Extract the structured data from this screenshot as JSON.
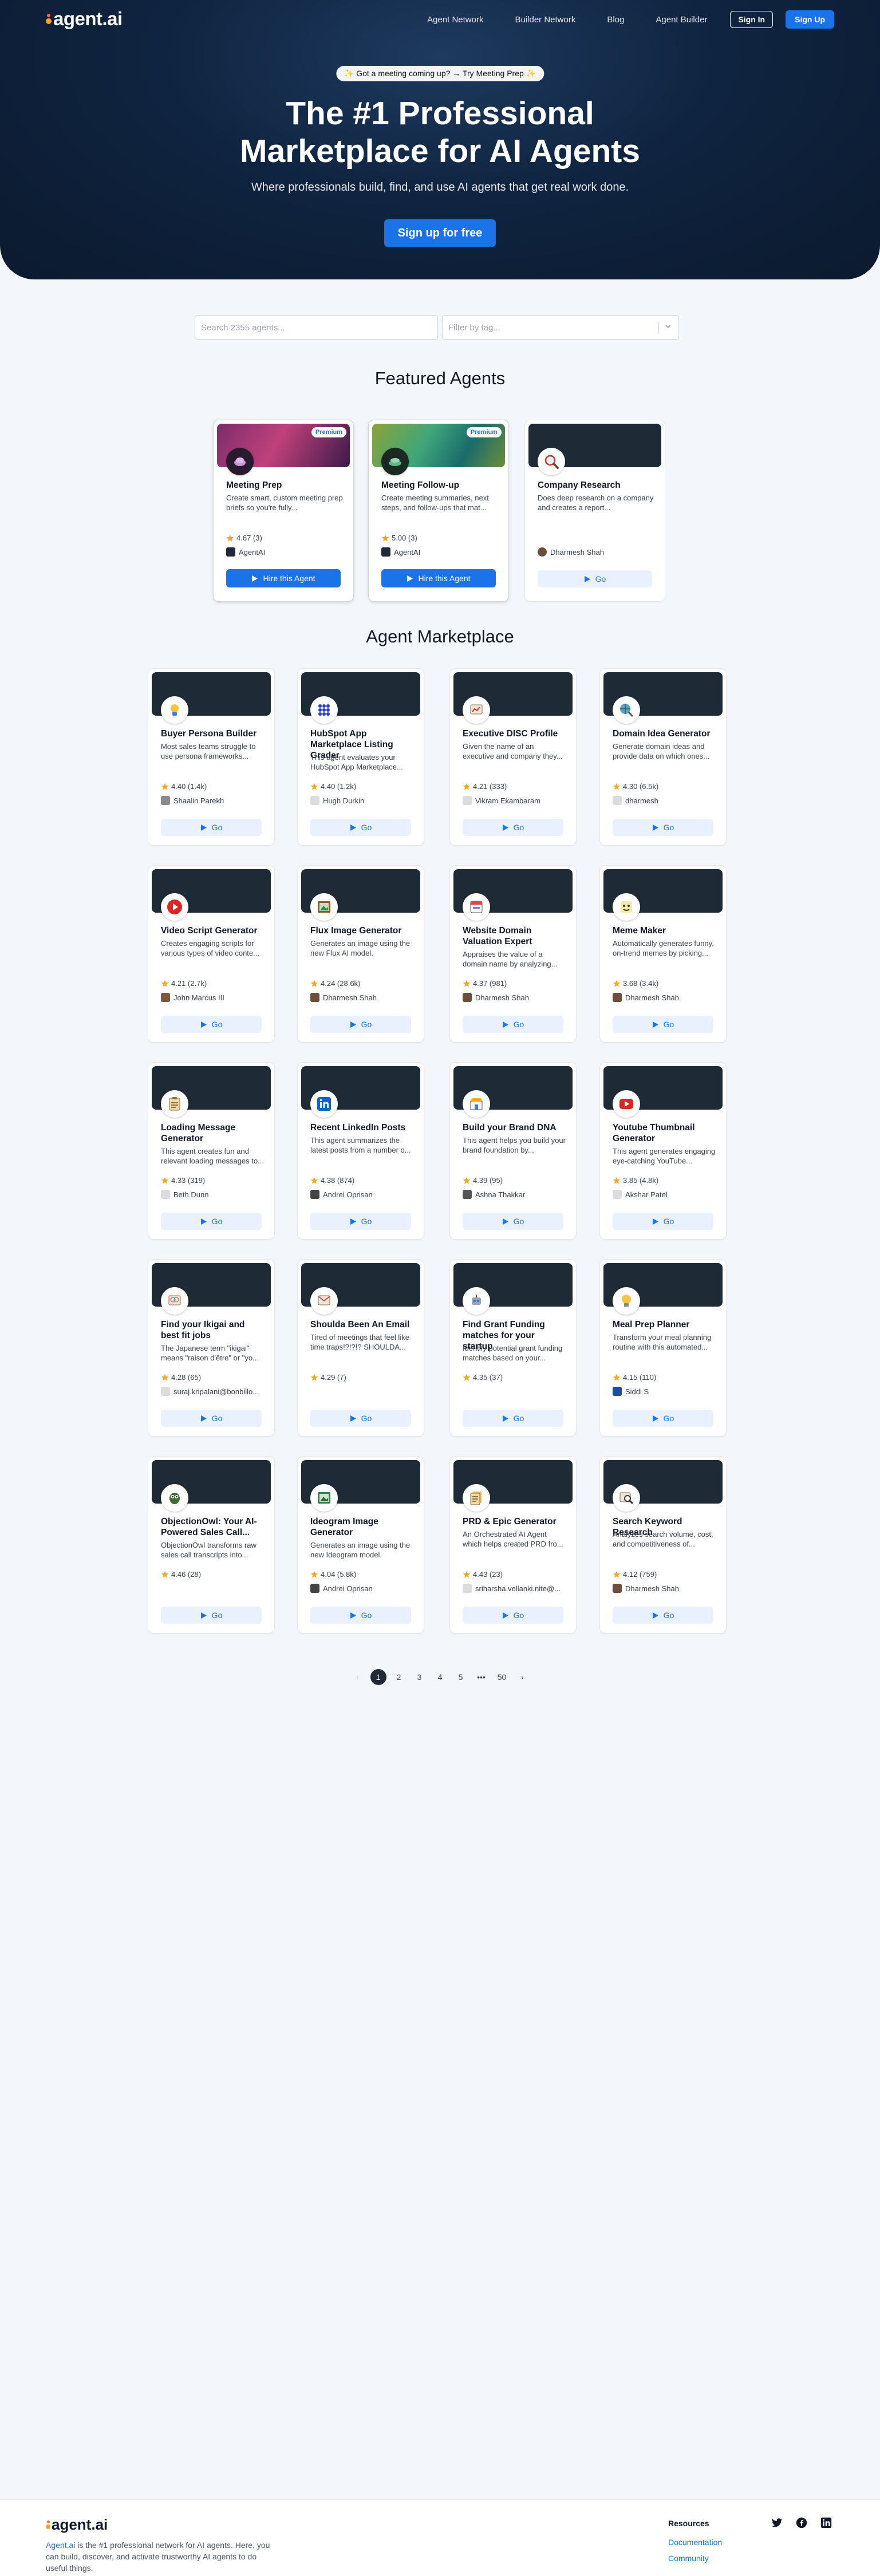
{
  "nav": {
    "logo": "agent.ai",
    "links": [
      "Agent Network",
      "Builder Network",
      "Blog",
      "Agent Builder"
    ],
    "sign_in": "Sign In",
    "sign_up": "Sign Up"
  },
  "hero": {
    "promo": "✨ Got a meeting coming up? → Try Meeting Prep ✨",
    "title_line1": "The #1 Professional",
    "title_line2": "Marketplace for AI Agents",
    "subtitle": "Where professionals build, find, and use AI agents that get real work done.",
    "cta": "Sign up for free"
  },
  "search": {
    "placeholder": "Search 2355 agents...",
    "tag_placeholder": "Filter by tag..."
  },
  "featured": {
    "title": "Featured Agents",
    "items": [
      {
        "title": "Meeting Prep",
        "desc": "Create smart, custom meeting prep briefs so you're fully...",
        "rating": "4.67 (3)",
        "author": "AgentAI",
        "premium": "Premium",
        "button": "Hire this Agent"
      },
      {
        "title": "Meeting Follow-up",
        "desc": "Create meeting summaries, next steps, and follow-ups that mat...",
        "rating": "5.00 (3)",
        "author": "AgentAI",
        "premium": "Premium",
        "button": "Hire this Agent"
      },
      {
        "title": "Company Research",
        "desc": "Does deep research on a company and creates a report...",
        "rating": "",
        "author": "Dharmesh Shah",
        "button": "Go"
      }
    ]
  },
  "marketplace": {
    "title": "Agent Marketplace",
    "items": [
      {
        "title": "Buyer Persona Builder",
        "desc": "Most sales teams struggle to use persona frameworks...",
        "rating": "4.40 (1.4k)",
        "author": "Shaalin Parekh",
        "button": "Go"
      },
      {
        "title": "HubSpot App Marketplace Listing Grader",
        "desc": "This agent evaluates your HubSpot App Marketplace...",
        "rating": "4.40 (1.2k)",
        "author": "Hugh Durkin",
        "button": "Go"
      },
      {
        "title": "Executive DISC Profile",
        "desc": "Given the name of an executive and company they...",
        "rating": "4.21 (333)",
        "author": "Vikram Ekambaram",
        "button": "Go"
      },
      {
        "title": "Domain Idea Generator",
        "desc": "Generate domain ideas and provide data on which ones...",
        "rating": "4.30 (6.5k)",
        "author": "dharmesh",
        "button": "Go"
      },
      {
        "title": "Video Script Generator",
        "desc": "Creates engaging scripts for various types of video conte...",
        "rating": "4.21 (2.7k)",
        "author": "John Marcus III",
        "button": "Go"
      },
      {
        "title": "Flux Image Generator",
        "desc": "Generates an image using the new Flux AI model.",
        "rating": "4.24 (28.6k)",
        "author": "Dharmesh Shah",
        "button": "Go"
      },
      {
        "title": "Website Domain Valuation Expert",
        "desc": "Appraises the value of a domain name by analyzing...",
        "rating": "4.37 (981)",
        "author": "Dharmesh Shah",
        "button": "Go"
      },
      {
        "title": "Meme Maker",
        "desc": "Automatically generates funny, on-trend memes by picking...",
        "rating": "3.68 (3.4k)",
        "author": "Dharmesh Shah",
        "button": "Go"
      },
      {
        "title": "Loading Message Generator",
        "desc": "This agent creates fun and relevant loading messages to...",
        "rating": "4.33 (319)",
        "author": "Beth Dunn",
        "button": "Go"
      },
      {
        "title": "Recent LinkedIn Posts",
        "desc": "This agent summarizes the latest posts from a number o...",
        "rating": "4.38 (874)",
        "author": "Andrei Oprisan",
        "button": "Go"
      },
      {
        "title": "Build your Brand DNA",
        "desc": "This agent helps you build your brand foundation by...",
        "rating": "4.39 (95)",
        "author": "Ashna Thakkar",
        "button": "Go"
      },
      {
        "title": "Youtube Thumbnail Generator",
        "desc": "This agent generates engaging eye-catching YouTube...",
        "rating": "3.85 (4.8k)",
        "author": "Akshar Patel",
        "button": "Go"
      },
      {
        "title": "Find your Ikigai and best fit jobs",
        "desc": "The Japanese term \"ikigai\" means \"raison d'être\" or \"yo...",
        "rating": "4.28 (65)",
        "author": "suraj.kripalani@bonbillo...",
        "button": "Go"
      },
      {
        "title": "Shoulda Been An Email",
        "desc": "Tired of meetings that feel like time traps!?!?!? SHOULDA...",
        "rating": "4.29 (7)",
        "author": "",
        "button": "Go"
      },
      {
        "title": "Find Grant Funding matches for your startup",
        "desc": "Identify potential grant funding matches based on your...",
        "rating": "4.35 (37)",
        "author": "",
        "button": "Go"
      },
      {
        "title": "Meal Prep Planner",
        "desc": "Transform your meal planning routine with this automated...",
        "rating": "4.15 (110)",
        "author": "Siddi S",
        "button": "Go"
      },
      {
        "title": "ObjectionOwl: Your AI-Powered Sales Call...",
        "desc": "ObjectionOwl transforms raw sales call transcripts into...",
        "rating": "4.46 (28)",
        "author": "",
        "button": "Go"
      },
      {
        "title": "Ideogram Image Generator",
        "desc": "Generates an image using the new Ideogram model.",
        "rating": "4.04 (5.8k)",
        "author": "Andrei Oprisan",
        "button": "Go"
      },
      {
        "title": "PRD & Epic Generator",
        "desc": "An Orchestrated AI Agent which helps created PRD fro...",
        "rating": "4.43 (23)",
        "author": "sriharsha.vellanki.nite@...",
        "button": "Go"
      },
      {
        "title": "Search Keyword Research",
        "desc": "Analyzes search volume, cost, and competitiveness of...",
        "rating": "4.12 (759)",
        "author": "Dharmesh Shah",
        "button": "Go"
      }
    ]
  },
  "pagination": {
    "prev": "‹",
    "pages": [
      "1",
      "2",
      "3",
      "4",
      "5"
    ],
    "ellipsis": "•••",
    "last": "50",
    "next": "›"
  },
  "footer": {
    "logo": "agent.ai",
    "about_brand": "Agent.ai",
    "about_rest": " is the #1 professional network for AI agents. Here, you can build, discover, and activate trustworthy AI agents to do useful things.",
    "resources_title": "Resources",
    "links": [
      "Documentation",
      "Community"
    ]
  },
  "colors": {
    "accent": "#1a73e8",
    "hero_bg": "#0f2440",
    "star": "#f5a623"
  }
}
